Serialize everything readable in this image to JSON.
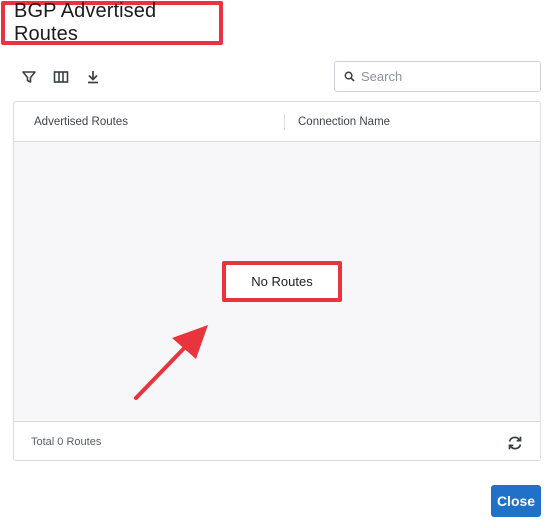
{
  "dialog": {
    "title": "BGP Advertised Routes"
  },
  "toolbar": {
    "icons": [
      "filter-icon",
      "columns-icon",
      "download-icon"
    ]
  },
  "search": {
    "placeholder": "Search",
    "value": ""
  },
  "table": {
    "columns": [
      "Advertised Routes",
      "Connection Name"
    ],
    "rows": [],
    "empty_message": "No Routes",
    "footer_total": "Total 0 Routes"
  },
  "actions": {
    "close_label": "Close"
  },
  "colors": {
    "highlight": "#e8343c",
    "primary": "#1f72c7",
    "empty_bg": "#f7f7fa"
  }
}
